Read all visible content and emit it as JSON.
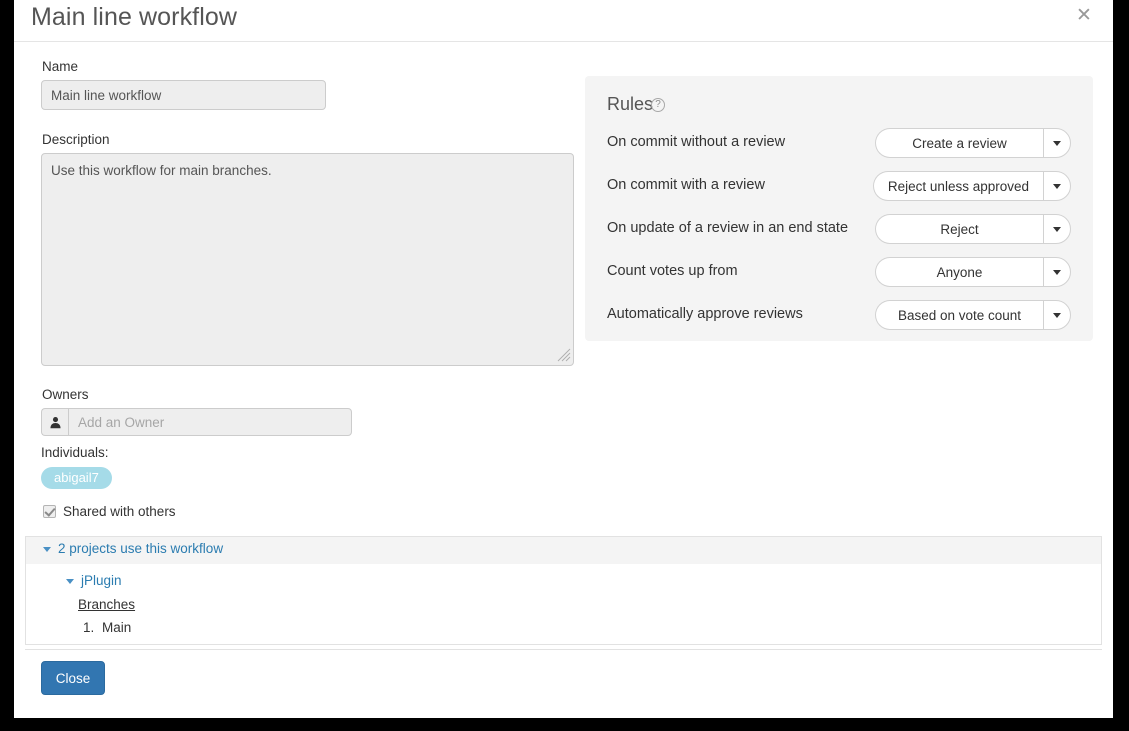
{
  "dialog": {
    "title": "Main line workflow",
    "close_icon": "close-x-icon",
    "footer_button": "Close"
  },
  "form": {
    "name_label": "Name",
    "name_value": "Main line workflow",
    "description_label": "Description",
    "description_value": "Use this workflow for main branches.",
    "owners_label": "Owners",
    "owners_placeholder": "Add an Owner",
    "owner_icon": "user-icon",
    "individuals_label": "Individuals:",
    "individuals": [
      "abigail7"
    ],
    "shared_label": "Shared with others",
    "shared_checked": true
  },
  "rules": {
    "title": "Rules",
    "help_icon": "question-circle-icon",
    "items": [
      {
        "label": "On commit without a review",
        "value": "Create a review"
      },
      {
        "label": "On commit with a review",
        "value": "Reject unless approved"
      },
      {
        "label": "On update of a review in an end state",
        "value": "Reject"
      },
      {
        "label": "Count votes up from",
        "value": "Anyone"
      },
      {
        "label": "Automatically approve reviews",
        "value": "Based on vote count"
      }
    ]
  },
  "projects": {
    "header": "2 projects use this workflow",
    "project_name": "jPlugin",
    "branches_label": "Branches",
    "branches": [
      "Main"
    ]
  },
  "colors": {
    "accent_blue": "#3276b1",
    "link_blue": "#2b7cb0",
    "tag_blue": "#a5dbe8",
    "panel_gray": "#f4f4f4"
  }
}
